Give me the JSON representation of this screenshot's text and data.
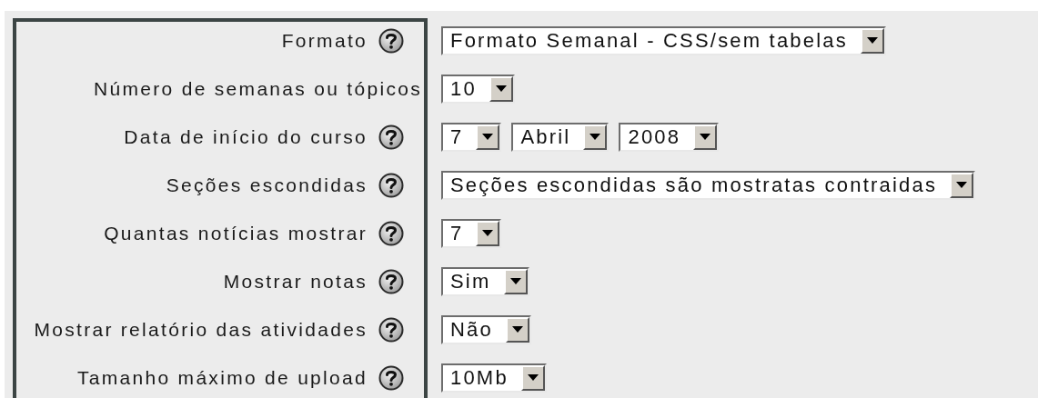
{
  "settings": [
    {
      "label": "Formato",
      "help": true,
      "selects": [
        {
          "value": "Formato Semanal - CSS/sem tabelas"
        }
      ]
    },
    {
      "label": "Número de semanas ou tópicos",
      "help": false,
      "selects": [
        {
          "value": "10"
        }
      ]
    },
    {
      "label": "Data de início do curso",
      "help": true,
      "selects": [
        {
          "value": "7"
        },
        {
          "value": "Abril"
        },
        {
          "value": "2008"
        }
      ]
    },
    {
      "label": "Seções escondidas",
      "help": true,
      "selects": [
        {
          "value": "Seções escondidas são mostratas contraidas"
        }
      ]
    },
    {
      "label": "Quantas notícias mostrar",
      "help": true,
      "selects": [
        {
          "value": "7"
        }
      ]
    },
    {
      "label": "Mostrar notas",
      "help": true,
      "selects": [
        {
          "value": "Sim"
        }
      ]
    },
    {
      "label": "Mostrar relatório das atividades",
      "help": true,
      "selects": [
        {
          "value": "Não"
        }
      ]
    },
    {
      "label": "Tamanho máximo de upload",
      "help": true,
      "selects": [
        {
          "value": "10Mb"
        }
      ]
    }
  ]
}
